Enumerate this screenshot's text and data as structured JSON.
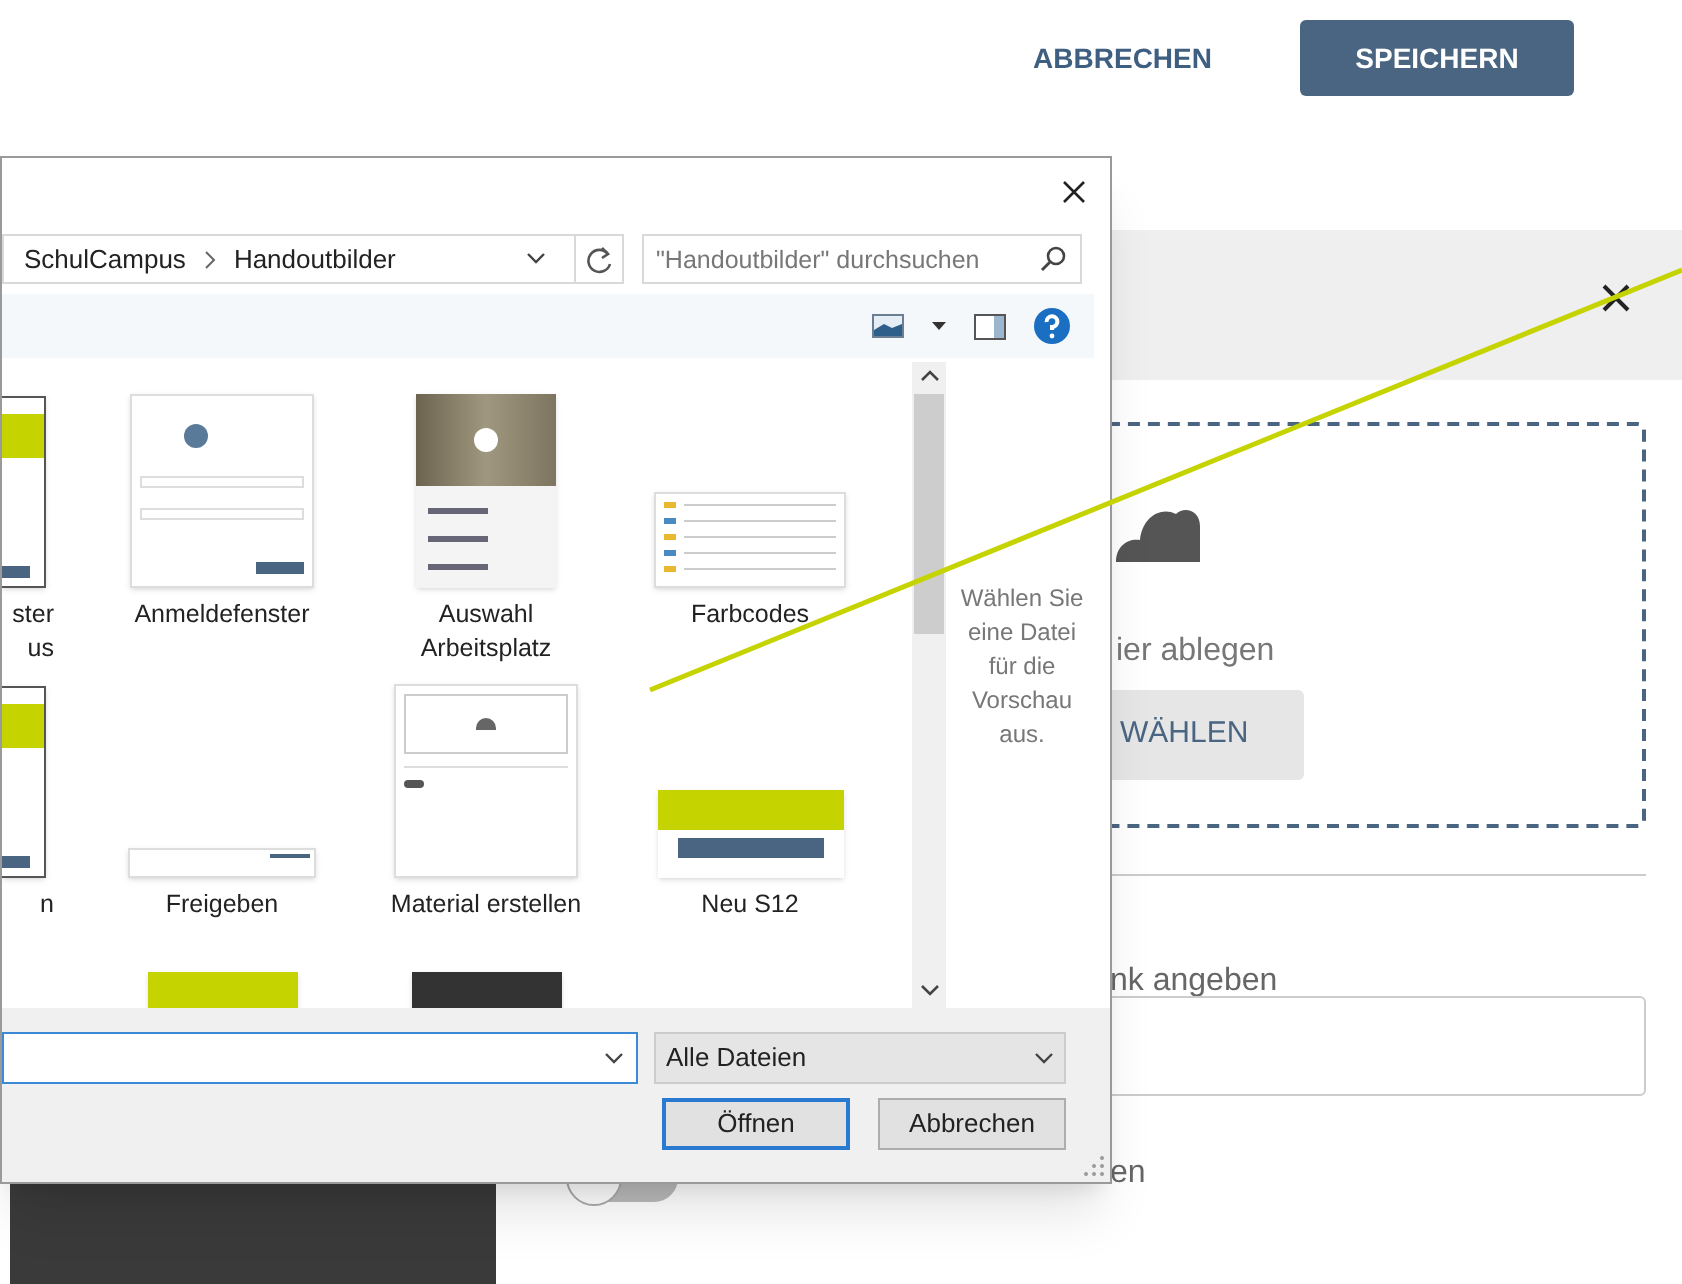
{
  "page_actions": [
    {
      "label": "ABBRECHEN",
      "kind": "link"
    },
    {
      "label": "SPEICHERN",
      "kind": "primary"
    }
  ],
  "upload_dialog": {
    "drop_text": "ier ablegen",
    "choose_button": "WÄHLEN",
    "link_label": "nk angeben",
    "toggle": {
      "on": false
    },
    "toggle_label": "en"
  },
  "file_dialog": {
    "breadcrumb": [
      "SchulCampus",
      "Handoutbilder"
    ],
    "search": {
      "placeholder": "\"Handoutbilder\" durchsuchen"
    },
    "rows": [
      {
        "cut_file": {
          "lines": [
            "ster",
            "us"
          ],
          "kind": "window"
        },
        "files": [
          {
            "lines": [
              "Anmeldefenster"
            ],
            "kind": "login"
          },
          {
            "lines": [
              "Auswahl",
              "Arbeitsplatz"
            ],
            "kind": "photo-menu"
          },
          {
            "lines": [
              "Farbcodes"
            ],
            "kind": "table"
          }
        ]
      },
      {
        "cut_file": {
          "lines": [
            "n"
          ],
          "kind": "window"
        },
        "files": [
          {
            "lines": [
              "Freigeben"
            ],
            "kind": "strip"
          },
          {
            "lines": [
              "Material erstellen"
            ],
            "kind": "upload"
          },
          {
            "lines": [
              "Neu S12"
            ],
            "kind": "banner"
          }
        ]
      },
      {
        "files": [
          {
            "kind": "banner-top"
          },
          {
            "kind": "dark-top"
          }
        ]
      }
    ],
    "preview_hint": "Wählen Sie eine Datei für die Vorschau aus.",
    "file_type": "Alle Dateien",
    "buttons": [
      {
        "label": "Öffnen",
        "default": true
      },
      {
        "label": "Abbrechen",
        "default": false
      }
    ]
  }
}
